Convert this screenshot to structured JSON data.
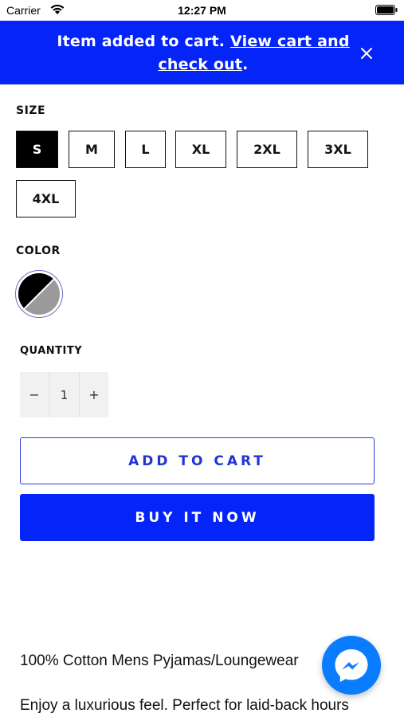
{
  "status_bar": {
    "carrier": "Carrier",
    "time": "12:27 PM"
  },
  "banner": {
    "message": "Item added to cart. ",
    "link_line1": "View cart and",
    "link_line2": "check out",
    "suffix": ".",
    "close_icon": "close-icon"
  },
  "size": {
    "label": "SIZE",
    "options": [
      "S",
      "M",
      "L",
      "XL",
      "2XL",
      "3XL",
      "4XL"
    ],
    "selected": "S"
  },
  "color": {
    "label": "COLOR",
    "swatch": [
      "#000000",
      "#9a9a9a"
    ]
  },
  "quantity": {
    "label": "QUANTITY",
    "minus": "−",
    "value": "1",
    "plus": "+"
  },
  "actions": {
    "add_to_cart": "ADD TO CART",
    "buy_now": "BUY IT NOW"
  },
  "description": {
    "line1": "100% Cotton Mens Pyjamas/Loungewear",
    "line2": "Enjoy a luxurious feel. Perfect for laid-back hours"
  },
  "colors": {
    "brand_blue": "#0524f7",
    "accent_outline": "#2b3bd9",
    "messenger_blue": "#0a7cff"
  },
  "chat": {
    "icon": "messenger-icon"
  }
}
